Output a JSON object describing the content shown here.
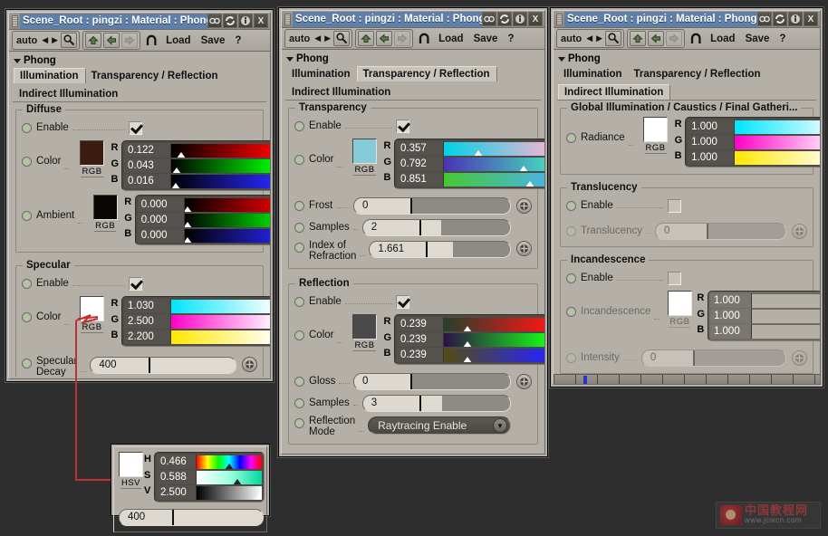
{
  "background_color": "#2e2e2e",
  "windows": [
    {
      "id": "illumination",
      "title": "Scene_Root : pingzi : Material : Phong",
      "toolbar": {
        "mode": "auto",
        "load": "Load",
        "save": "Save",
        "help": "?"
      },
      "section_label": "Phong",
      "tabs": [
        {
          "label": "Illumination",
          "active": true
        },
        {
          "label": "Transparency / Reflection",
          "active": false
        }
      ],
      "tab2": [
        {
          "label": "Indirect Illumination",
          "active": false
        }
      ],
      "groups": [
        {
          "label": "Diffuse",
          "rows": [
            {
              "type": "checkbox",
              "label": "Enable",
              "checked": true
            },
            {
              "type": "color",
              "label": "Color",
              "swatch_label": "RGB",
              "swatch": "#3a1d10",
              "channels": [
                {
                  "name": "R",
                  "value": "0.122",
                  "marker": 10,
                  "gradient": "linear-gradient(to right,#000000,#ff0000)"
                },
                {
                  "name": "G",
                  "value": "0.043",
                  "marker": 4,
                  "gradient": "linear-gradient(to right,#000000,#00ff00)"
                },
                {
                  "name": "B",
                  "value": "0.016",
                  "marker": 2,
                  "gradient": "linear-gradient(to right,#000000,#2020ff)"
                }
              ]
            },
            {
              "type": "color",
              "label": "Ambient",
              "swatch_label": "RGB",
              "swatch": "#0a0705",
              "channels": [
                {
                  "name": "R",
                  "value": "0.000",
                  "marker": 0,
                  "gradient": "linear-gradient(to right,#000000,#ff0000)"
                },
                {
                  "name": "G",
                  "value": "0.000",
                  "marker": 0,
                  "gradient": "linear-gradient(to right,#000000,#00ff00)"
                },
                {
                  "name": "B",
                  "value": "0.000",
                  "marker": 0,
                  "gradient": "linear-gradient(to right,#000000,#2020ff)"
                }
              ]
            }
          ]
        },
        {
          "label": "Specular",
          "rows": [
            {
              "type": "checkbox",
              "label": "Enable",
              "checked": true
            },
            {
              "type": "color",
              "label": "Color",
              "swatch_label": "RGB",
              "swatch": "#ffffff",
              "channels": [
                {
                  "name": "R",
                  "value": "1.030",
                  "marker": 100,
                  "gradient": "linear-gradient(to right,#00e5ff,#ffffff)"
                },
                {
                  "name": "G",
                  "value": "2.500",
                  "marker": 100,
                  "gradient": "linear-gradient(to right,#ff00c8,#ffffff)"
                },
                {
                  "name": "B",
                  "value": "2.200",
                  "marker": 100,
                  "gradient": "linear-gradient(to right,#ffe800,#ffffff)"
                }
              ]
            },
            {
              "type": "slider",
              "label": "Specular",
              "label2": "Decay",
              "value": "400",
              "fill": 38
            }
          ]
        }
      ]
    },
    {
      "id": "transparency-reflection",
      "title": "Scene_Root : pingzi : Material : Phong",
      "toolbar": {
        "mode": "auto",
        "load": "Load",
        "save": "Save",
        "help": "?"
      },
      "section_label": "Phong",
      "tabs": [
        {
          "label": "Illumination",
          "active": false
        },
        {
          "label": "Transparency / Reflection",
          "active": true
        }
      ],
      "tab2": [
        {
          "label": "Indirect Illumination",
          "active": false
        }
      ],
      "groups": [
        {
          "label": "Transparency",
          "rows": [
            {
              "type": "checkbox",
              "label": "Enable",
              "checked": true
            },
            {
              "type": "color",
              "label": "Color",
              "swatch_label": "RGB",
              "swatch": "#86ccd8",
              "channels": [
                {
                  "name": "R",
                  "value": "0.357",
                  "marker": 34,
                  "gradient": "linear-gradient(to right,#00d2e8,#f0b8d8)"
                },
                {
                  "name": "G",
                  "value": "0.792",
                  "marker": 76,
                  "gradient": "linear-gradient(to right,#4b32b4,#46d8c0)"
                },
                {
                  "name": "B",
                  "value": "0.851",
                  "marker": 82,
                  "gradient": "linear-gradient(to right,#46c832,#4ab4e6)"
                }
              ]
            },
            {
              "type": "slider",
              "label": "Frost",
              "value": "0",
              "fill": 37
            },
            {
              "type": "slider",
              "label": "Samples",
              "value": "2",
              "fill": 38,
              "extra_fill": 22
            },
            {
              "type": "slider",
              "label": "Index of",
              "label2": "Refraction",
              "value": "1.661",
              "fill": 38,
              "extra_fill": 28
            }
          ]
        },
        {
          "label": "Reflection",
          "rows": [
            {
              "type": "checkbox",
              "label": "Enable",
              "checked": true
            },
            {
              "type": "color",
              "label": "Color",
              "swatch_label": "RGB",
              "swatch": "#4a4a4a",
              "channels": [
                {
                  "name": "R",
                  "value": "0.239",
                  "marker": 23,
                  "gradient": "linear-gradient(to right,#244c30,#ff1010)"
                },
                {
                  "name": "G",
                  "value": "0.239",
                  "marker": 23,
                  "gradient": "linear-gradient(to right,#30104a,#10ff10)"
                },
                {
                  "name": "B",
                  "value": "0.239",
                  "marker": 23,
                  "gradient": "linear-gradient(to right,#5a5410,#2020ff)"
                }
              ]
            },
            {
              "type": "slider",
              "label": "Gloss",
              "value": "0",
              "fill": 37
            },
            {
              "type": "slider",
              "label": "Samples",
              "value": "3",
              "fill": 38,
              "extra_fill": 22
            },
            {
              "type": "combo",
              "label": "Reflection",
              "label2": "Mode",
              "value": "Raytracing Enable"
            }
          ]
        }
      ]
    },
    {
      "id": "indirect-illumination",
      "title": "Scene_Root : pingzi : Material : Phong",
      "toolbar": {
        "mode": "auto",
        "load": "Load",
        "save": "Save",
        "help": "?"
      },
      "section_label": "Phong",
      "tabs": [
        {
          "label": "Illumination",
          "active": false
        },
        {
          "label": "Transparency / Reflection",
          "active": false
        }
      ],
      "tab2": [
        {
          "label": "Indirect Illumination",
          "active": true
        }
      ],
      "groups": [
        {
          "label": "Global Illumination / Caustics / Final Gatheri...",
          "rows": [
            {
              "type": "color",
              "label": "Radiance",
              "swatch_label": "RGB",
              "swatch": "#ffffff",
              "channels": [
                {
                  "name": "R",
                  "value": "1.000",
                  "marker": 100,
                  "gradient": "linear-gradient(to right,#00e5ff,#ffffff)"
                },
                {
                  "name": "G",
                  "value": "1.000",
                  "marker": 100,
                  "gradient": "linear-gradient(to right,#ff00c8,#ffffff)"
                },
                {
                  "name": "B",
                  "value": "1.000",
                  "marker": 100,
                  "gradient": "linear-gradient(to right,#ffe800,#ffffff)"
                }
              ]
            }
          ]
        },
        {
          "label": "Translucency",
          "rows": [
            {
              "type": "checkbox",
              "label": "Enable",
              "checked": false
            },
            {
              "type": "slider",
              "label": "Translucency",
              "value": "0",
              "fill": 36,
              "disabled": true
            }
          ]
        },
        {
          "label": "Incandescence",
          "rows": [
            {
              "type": "checkbox",
              "label": "Enable",
              "checked": false
            },
            {
              "type": "color",
              "label": "Incandescence",
              "swatch_label": "RGB",
              "swatch": "#ffffff",
              "disabled": true,
              "channels": [
                {
                  "name": "R",
                  "value": "1.000",
                  "marker": 100,
                  "gradient": "linear-gradient(to right,#b4b0a8,#b4b0a8)"
                },
                {
                  "name": "G",
                  "value": "1.000",
                  "marker": 100,
                  "gradient": "linear-gradient(to right,#b4b0a8,#b4b0a8)"
                },
                {
                  "name": "B",
                  "value": "1.000",
                  "marker": 100,
                  "gradient": "linear-gradient(to right,#c8c4bc,#c8c4bc)"
                }
              ]
            },
            {
              "type": "slider",
              "label": "Intensity",
              "value": "0",
              "fill": 36,
              "disabled": true
            }
          ]
        }
      ]
    }
  ],
  "popup": {
    "swatch": "#ffffff",
    "swatch_label": "HSV",
    "channels": [
      {
        "name": "H",
        "value": "0.466",
        "marker": 47,
        "gradient": "linear-gradient(to right,#ff0000,#ffff00,#00ff00,#00ffff,#0000ff,#ff00ff,#ff0000)"
      },
      {
        "name": "S",
        "value": "0.588",
        "marker": 60,
        "gradient": "linear-gradient(to right,#ffffff,#9fffe0,#00d8a0)"
      },
      {
        "name": "V",
        "value": "2.500",
        "marker": 100,
        "gradient": "linear-gradient(to right,#000000,#ffffff)"
      }
    ],
    "slider": {
      "value": "400",
      "fill": 38
    }
  },
  "watermark": {
    "text_cn": "中国教程网",
    "url": "www.jcwcn.com"
  }
}
